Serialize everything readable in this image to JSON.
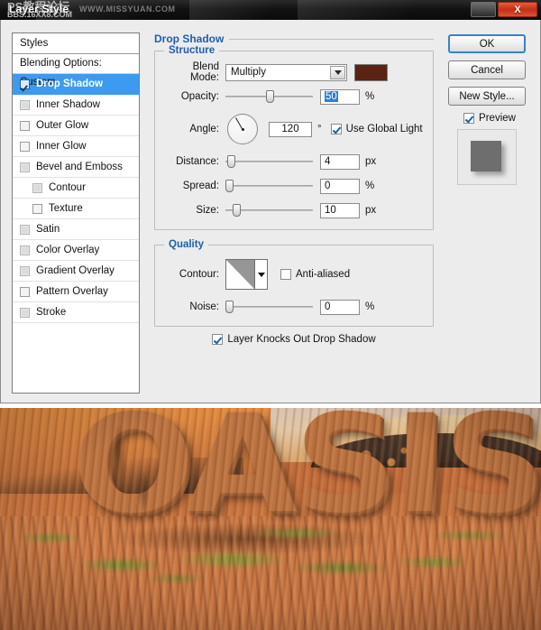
{
  "titlebar": {
    "title": "Layer Style",
    "watermark_cn": "PS教程论坛",
    "watermark_bbs": "BBS.16XX8.COM",
    "watermark_site": "WWW.MISSYUAN.COM",
    "minimize_label": "",
    "close_label": "X"
  },
  "styles_panel": {
    "header": "Styles",
    "blending_options": "Blending Options: Custom",
    "items": [
      {
        "label": "Drop Shadow",
        "checked": true,
        "selected": true,
        "indent": false,
        "enabled": true
      },
      {
        "label": "Inner Shadow",
        "checked": false,
        "selected": false,
        "indent": false,
        "enabled": false
      },
      {
        "label": "Outer Glow",
        "checked": false,
        "selected": false,
        "indent": false,
        "enabled": true
      },
      {
        "label": "Inner Glow",
        "checked": false,
        "selected": false,
        "indent": false,
        "enabled": true
      },
      {
        "label": "Bevel and Emboss",
        "checked": false,
        "selected": false,
        "indent": false,
        "enabled": false
      },
      {
        "label": "Contour",
        "checked": false,
        "selected": false,
        "indent": true,
        "enabled": false
      },
      {
        "label": "Texture",
        "checked": false,
        "selected": false,
        "indent": true,
        "enabled": true
      },
      {
        "label": "Satin",
        "checked": false,
        "selected": false,
        "indent": false,
        "enabled": false
      },
      {
        "label": "Color Overlay",
        "checked": false,
        "selected": false,
        "indent": false,
        "enabled": false
      },
      {
        "label": "Gradient Overlay",
        "checked": false,
        "selected": false,
        "indent": false,
        "enabled": false
      },
      {
        "label": "Pattern Overlay",
        "checked": false,
        "selected": false,
        "indent": false,
        "enabled": true
      },
      {
        "label": "Stroke",
        "checked": false,
        "selected": false,
        "indent": false,
        "enabled": false
      }
    ]
  },
  "effect": {
    "title": "Drop Shadow",
    "structure": {
      "legend": "Structure",
      "blend_mode_label": "Blend Mode:",
      "blend_mode_value": "Multiply",
      "shadow_color": "#5a2314",
      "opacity_label": "Opacity:",
      "opacity_value": "50",
      "opacity_unit": "%",
      "opacity_pct": 50,
      "angle_label": "Angle:",
      "angle_value": "120",
      "angle_unit": "°",
      "angle_deg": 120,
      "use_global_light_label": "Use Global Light",
      "use_global_light_checked": true,
      "distance_label": "Distance:",
      "distance_value": "4",
      "distance_unit": "px",
      "distance_pct": 4,
      "spread_label": "Spread:",
      "spread_value": "0",
      "spread_unit": "%",
      "spread_pct": 0,
      "size_label": "Size:",
      "size_value": "10",
      "size_unit": "px",
      "size_pct": 10
    },
    "quality": {
      "legend": "Quality",
      "contour_label": "Contour:",
      "anti_aliased_label": "Anti-aliased",
      "anti_aliased_checked": false,
      "noise_label": "Noise:",
      "noise_value": "0",
      "noise_unit": "%",
      "noise_pct": 0,
      "knocks_out_label": "Layer Knocks Out Drop Shadow",
      "knocks_out_checked": true
    }
  },
  "buttons": {
    "ok": "OK",
    "cancel": "Cancel",
    "new_style": "New Style...",
    "preview_label": "Preview",
    "preview_checked": true
  },
  "photo": {
    "headline_text": "OASIS",
    "description": "Desert dunes with 3D sand-textured OASIS lettering and green grass"
  },
  "colors": {
    "dialog_bg": "#ececec",
    "selection_blue": "#3c9bf0",
    "group_title_blue": "#1f5fa8",
    "shadow_swatch": "#5a2314",
    "titlebar": "#111111",
    "close_red": "#c23018"
  }
}
